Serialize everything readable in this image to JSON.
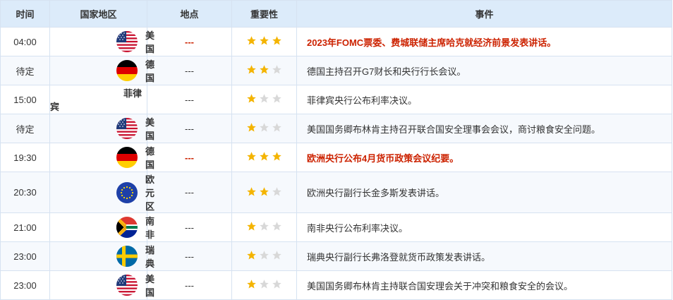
{
  "headers": {
    "time": "时间",
    "country": "国家地区",
    "place": "地点",
    "importance": "重要性",
    "event": "事件"
  },
  "colors": {
    "header_bg": "#dcebfa",
    "high_text": "#cc2200",
    "star_on": "#f4b400",
    "star_off": "#d8d8d8"
  },
  "rows": [
    {
      "time": "04:00",
      "country": "美国",
      "flag": "us",
      "place": "---",
      "importance": 3,
      "event": "2023年FOMC票委、费城联储主席哈克就经济前景发表讲话。",
      "high": true
    },
    {
      "time": "待定",
      "country": "德国",
      "flag": "de",
      "place": "---",
      "importance": 2,
      "event": "德国主持召开G7财长和央行行长会议。",
      "high": false
    },
    {
      "time": "15:00",
      "country": "菲律宾",
      "flag": "",
      "place": "---",
      "importance": 1,
      "event": "菲律宾央行公布利率决议。",
      "high": false
    },
    {
      "time": "待定",
      "country": "美国",
      "flag": "us",
      "place": "---",
      "importance": 1,
      "event": "美国国务卿布林肯主持召开联合国安全理事会会议，商讨粮食安全问题。",
      "high": false
    },
    {
      "time": "19:30",
      "country": "德国",
      "flag": "de",
      "place": "---",
      "importance": 3,
      "event": "欧洲央行公布4月货币政策会议纪要。",
      "high": true
    },
    {
      "time": "20:30",
      "country": "欧元区",
      "flag": "eu",
      "place": "---",
      "importance": 2,
      "event": "欧洲央行副行长金多斯发表讲话。",
      "high": false
    },
    {
      "time": "21:00",
      "country": "南非",
      "flag": "za",
      "place": "---",
      "importance": 1,
      "event": "南非央行公布利率决议。",
      "high": false
    },
    {
      "time": "23:00",
      "country": "瑞典",
      "flag": "se",
      "place": "---",
      "importance": 1,
      "event": "瑞典央行副行长弗洛登就货币政策发表讲话。",
      "high": false
    },
    {
      "time": "23:00",
      "country": "美国",
      "flag": "us",
      "place": "---",
      "importance": 1,
      "event": "美国国务卿布林肯主持联合国安理会关于冲突和粮食安全的会议。",
      "high": false
    }
  ]
}
